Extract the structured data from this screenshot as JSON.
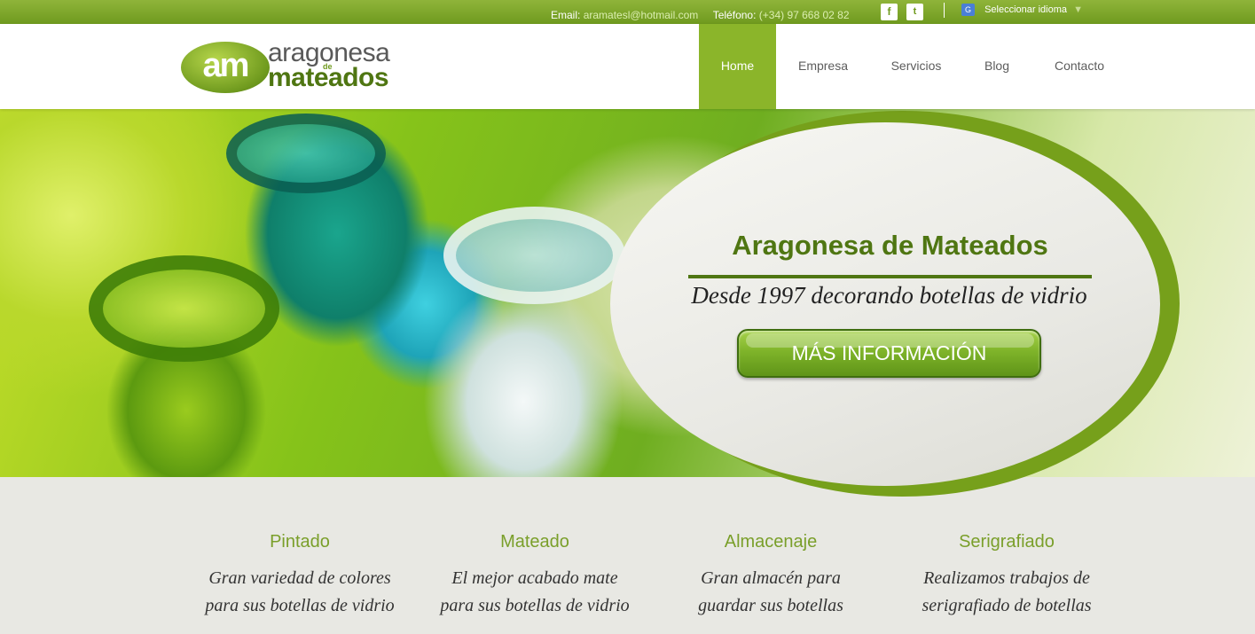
{
  "topbar": {
    "email_label": "Email:",
    "email_value": "aramatesl@hotmail.com",
    "phone_label": "Teléfono:",
    "phone_value": "(+34) 97 668 02 82",
    "facebook_glyph": "f",
    "twitter_glyph": "t",
    "language_label": "Seleccionar idioma",
    "language_caret": "▼"
  },
  "logo": {
    "badge": "am",
    "line1": "aragonesa",
    "connector": "de",
    "line2": "mateados"
  },
  "nav": {
    "items": [
      {
        "label": "Home",
        "active": true
      },
      {
        "label": "Empresa",
        "active": false
      },
      {
        "label": "Servicios",
        "active": false
      },
      {
        "label": "Blog",
        "active": false
      },
      {
        "label": "Contacto",
        "active": false
      }
    ]
  },
  "hero": {
    "title": "Aragonesa de Mateados",
    "subtitle": "Desde 1997 decorando botellas de vidrio",
    "cta_label": "MÁS INFORMACIÓN"
  },
  "features": [
    {
      "title": "Pintado",
      "line1": "Gran variedad de colores",
      "line2": "para sus botellas de vidrio"
    },
    {
      "title": "Mateado",
      "line1": "El mejor acabado mate",
      "line2": "para sus botellas de vidrio"
    },
    {
      "title": "Almacenaje",
      "line1": "Gran almacén para",
      "line2": "guardar sus botellas"
    },
    {
      "title": "Serigrafiado",
      "line1": "Realizamos trabajos de",
      "line2": "serigrafiado de botellas"
    }
  ],
  "colors": {
    "brand_green": "#8bb52a",
    "dark_green": "#4f7612",
    "feature_title": "#7a9f2a"
  }
}
